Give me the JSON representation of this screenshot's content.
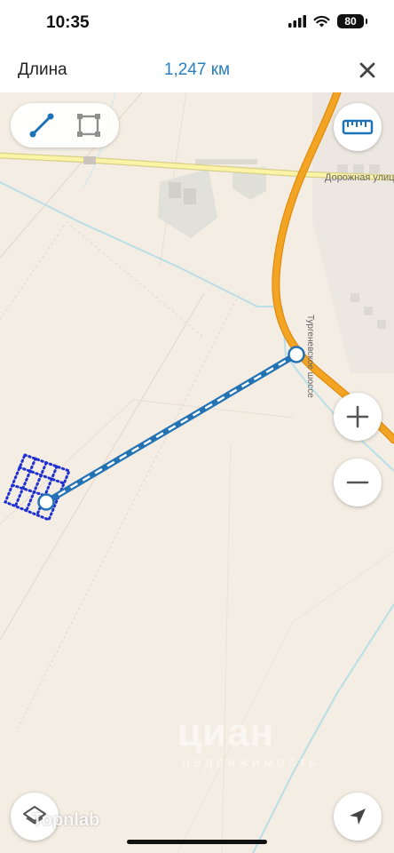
{
  "status_bar": {
    "time": "10:35",
    "battery": "80"
  },
  "header": {
    "label": "Длина",
    "distance": "1,247 км"
  },
  "map": {
    "road_label": "Дорожная улица",
    "road_label_vertical": "Тургеневское шоссе",
    "road_color": "#f4a423",
    "route_color": "#2272b4",
    "area_color": "#1f2fd1"
  },
  "watermark": {
    "text": "циан",
    "subtext": "недвижимость"
  },
  "attribution": "Topnlab",
  "icons": {
    "close": "close-icon",
    "line_tool": "line-tool-icon",
    "area_tool": "area-tool-icon",
    "ruler": "ruler-icon",
    "zoom_in": "plus-icon",
    "zoom_out": "minus-icon",
    "layers": "layers-icon",
    "locate": "navigation-arrow-icon"
  }
}
